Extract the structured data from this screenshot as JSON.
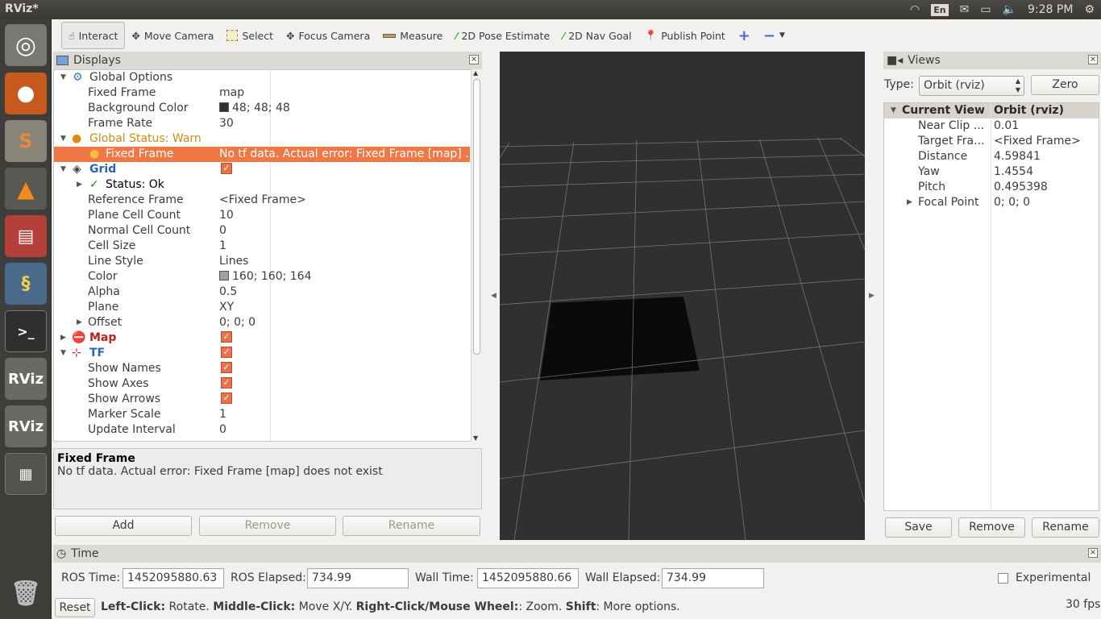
{
  "window": {
    "title": "RViz*"
  },
  "tray": {
    "lang": "En",
    "time": "9:28 PM"
  },
  "launcher": {
    "items": [
      "ubuntu",
      "firefox",
      "sublime",
      "vlc",
      "files",
      "python",
      "terminal",
      "rviz",
      "rviz",
      "workspace",
      "trash"
    ]
  },
  "toolbar": {
    "tools": [
      {
        "label": "Interact",
        "icon": "hand-icon"
      },
      {
        "label": "Move Camera",
        "icon": "move-camera-icon"
      },
      {
        "label": "Select",
        "icon": "select-icon"
      },
      {
        "label": "Focus Camera",
        "icon": "focus-camera-icon"
      },
      {
        "label": "Measure",
        "icon": "measure-icon"
      },
      {
        "label": "2D Pose Estimate",
        "icon": "pose-estimate-icon"
      },
      {
        "label": "2D Nav Goal",
        "icon": "nav-goal-icon"
      },
      {
        "label": "Publish Point",
        "icon": "publish-point-icon"
      }
    ]
  },
  "displays": {
    "title": "Displays",
    "rows": [
      {
        "name": "Global Options",
        "value": ""
      },
      {
        "name": "Fixed Frame",
        "value": "map"
      },
      {
        "name": "Background Color",
        "value": "48; 48; 48",
        "swatch": "#303030"
      },
      {
        "name": "Frame Rate",
        "value": "30"
      },
      {
        "name": "Global Status: Warn",
        "value": ""
      },
      {
        "name": "Fixed Frame",
        "value": "No tf data.  Actual error: Fixed Frame [map] ..."
      },
      {
        "name": "Grid",
        "value": ""
      },
      {
        "name": "Status: Ok",
        "value": ""
      },
      {
        "name": "Reference Frame",
        "value": "<Fixed Frame>"
      },
      {
        "name": "Plane Cell Count",
        "value": "10"
      },
      {
        "name": "Normal Cell Count",
        "value": "0"
      },
      {
        "name": "Cell Size",
        "value": "1"
      },
      {
        "name": "Line Style",
        "value": "Lines"
      },
      {
        "name": "Color",
        "value": "160; 160; 164",
        "swatch": "#a0a0a4"
      },
      {
        "name": "Alpha",
        "value": "0.5"
      },
      {
        "name": "Plane",
        "value": "XY"
      },
      {
        "name": "Offset",
        "value": "0; 0; 0"
      },
      {
        "name": "Map",
        "value": ""
      },
      {
        "name": "TF",
        "value": ""
      },
      {
        "name": "Show Names",
        "value": ""
      },
      {
        "name": "Show Axes",
        "value": ""
      },
      {
        "name": "Show Arrows",
        "value": ""
      },
      {
        "name": "Marker Scale",
        "value": "1"
      },
      {
        "name": "Update Interval",
        "value": "0"
      }
    ],
    "desc_title": "Fixed Frame",
    "desc_text": "No tf data. Actual error: Fixed Frame [map] does not exist",
    "buttons": {
      "add": "Add",
      "remove": "Remove",
      "rename": "Rename"
    }
  },
  "views": {
    "title": "Views",
    "type_label": "Type:",
    "type_value": "Orbit (rviz)",
    "zero": "Zero",
    "header": [
      "Current View",
      "Orbit (rviz)"
    ],
    "rows": [
      {
        "name": "Near Clip ...",
        "value": "0.01"
      },
      {
        "name": "Target Fra...",
        "value": "<Fixed Frame>"
      },
      {
        "name": "Distance",
        "value": "4.59841"
      },
      {
        "name": "Yaw",
        "value": "1.4554"
      },
      {
        "name": "Pitch",
        "value": "0.495398"
      },
      {
        "name": "Focal Point",
        "value": "0; 0; 0"
      }
    ],
    "buttons": {
      "save": "Save",
      "remove": "Remove",
      "rename": "Rename"
    }
  },
  "time": {
    "title": "Time",
    "ros_time_label": "ROS Time:",
    "ros_time": "1452095880.63",
    "ros_elapsed_label": "ROS Elapsed:",
    "ros_elapsed": "734.99",
    "wall_time_label": "Wall Time:",
    "wall_time": "1452095880.66",
    "wall_elapsed_label": "Wall Elapsed:",
    "wall_elapsed": "734.99",
    "experimental": "Experimental"
  },
  "status": {
    "reset": "Reset",
    "lc": "Left-Click:",
    "lc_t": " Rotate. ",
    "mc": "Middle-Click:",
    "mc_t": " Move X/Y. ",
    "rc": "Right-Click/Mouse Wheel:",
    "rc_t": ": Zoom. ",
    "sh": "Shift",
    "sh_t": ": More options.",
    "fps": "30 fps"
  },
  "colors": {
    "warn_row": "#f07746",
    "viewport_bg": "#303030",
    "accent": "#e8734a"
  }
}
